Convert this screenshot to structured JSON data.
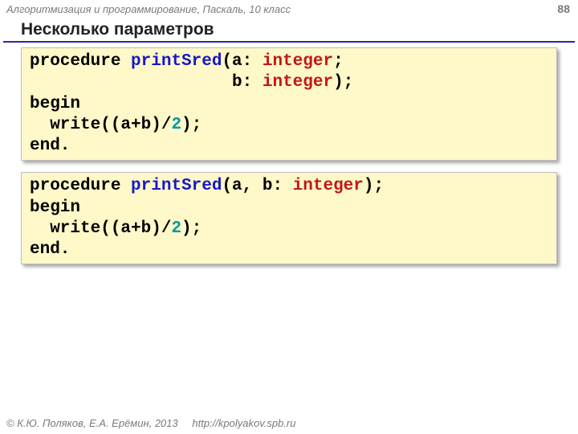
{
  "header": {
    "course": "Алгоритмизация и программирование, Паскаль, 10 класс",
    "page": "88"
  },
  "title": "Несколько параметров",
  "code1": {
    "l1a": "procedure ",
    "l1b": "printSred",
    "l1c": "(a: ",
    "l1d": "integer",
    "l1e": ";",
    "l2a": "                    b: ",
    "l2b": "integer",
    "l2c": ");",
    "l3": "begin",
    "l4a": "  write((a+b)/",
    "l4b": "2",
    "l4c": ");",
    "l5": "end."
  },
  "code2": {
    "l1a": "procedure ",
    "l1b": "printSred",
    "l1c": "(a, b: ",
    "l1d": "integer",
    "l1e": ");",
    "l2": "begin",
    "l3a": "  write((a+b)/",
    "l3b": "2",
    "l3c": ");",
    "l4": "end."
  },
  "footer": {
    "copyright": "© К.Ю. Поляков, Е.А. Ерёмин, 2013",
    "url": "http://kpolyakov.spb.ru"
  }
}
